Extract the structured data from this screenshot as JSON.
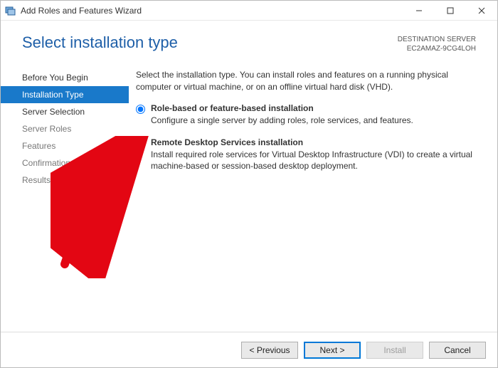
{
  "window": {
    "title": "Add Roles and Features Wizard"
  },
  "header": {
    "title": "Select installation type",
    "dest_label": "DESTINATION SERVER",
    "dest_server": "EC2AMAZ-9CG4LOH"
  },
  "nav": {
    "items": [
      {
        "label": "Before You Begin",
        "enabled": true,
        "active": false
      },
      {
        "label": "Installation Type",
        "enabled": true,
        "active": true
      },
      {
        "label": "Server Selection",
        "enabled": true,
        "active": false
      },
      {
        "label": "Server Roles",
        "enabled": false,
        "active": false
      },
      {
        "label": "Features",
        "enabled": false,
        "active": false
      },
      {
        "label": "Confirmation",
        "enabled": false,
        "active": false
      },
      {
        "label": "Results",
        "enabled": false,
        "active": false
      }
    ]
  },
  "main": {
    "intro": "Select the installation type. You can install roles and features on a running physical computer or virtual machine, or on an offline virtual hard disk (VHD).",
    "options": [
      {
        "title": "Role-based or feature-based installation",
        "desc": "Configure a single server by adding roles, role services, and features.",
        "selected": true
      },
      {
        "title": "Remote Desktop Services installation",
        "desc": "Install required role services for Virtual Desktop Infrastructure (VDI) to create a virtual machine-based or session-based desktop deployment.",
        "selected": false
      }
    ]
  },
  "footer": {
    "previous": "< Previous",
    "next": "Next >",
    "install": "Install",
    "cancel": "Cancel"
  },
  "annotation": {
    "color": "#e30613"
  }
}
